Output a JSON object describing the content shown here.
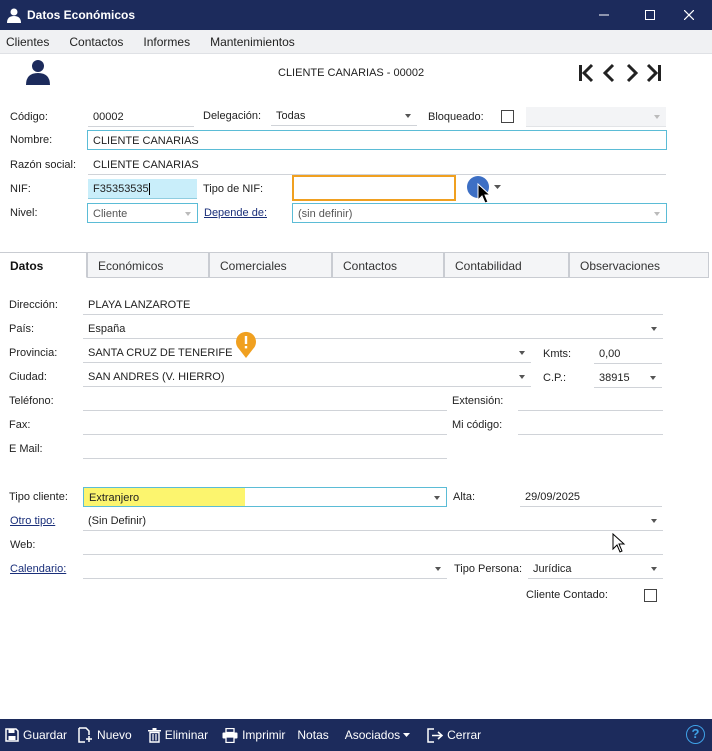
{
  "window": {
    "title": "Datos Económicos"
  },
  "menu": [
    "Clientes",
    "Contactos",
    "Informes",
    "Mantenimientos"
  ],
  "header": {
    "record_title": "CLIENTE CANARIAS - 00002"
  },
  "form": {
    "codigo_label": "Código:",
    "codigo": "00002",
    "delegacion_label": "Delegación:",
    "delegacion": "Todas",
    "bloqueado_label": "Bloqueado:",
    "nombre_label": "Nombre:",
    "nombre": "CLIENTE CANARIAS",
    "razon_label": "Razón social:",
    "razon": "CLIENTE CANARIAS",
    "nif_label": "NIF:",
    "nif": "F35353535",
    "tipo_nif_label": "Tipo de NIF:",
    "tipo_nif": "",
    "nivel_label": "Nivel:",
    "nivel": "Cliente",
    "depende_label": "Depende de:",
    "depende": "(sin definir)"
  },
  "tabs": [
    "Datos",
    "Económicos",
    "Comerciales",
    "Contactos",
    "Contabilidad",
    "Observaciones"
  ],
  "datos": {
    "direccion_label": "Dirección:",
    "direccion": "PLAYA LANZAROTE",
    "pais_label": "País:",
    "pais": "España",
    "provincia_label": "Provincia:",
    "provincia": "SANTA CRUZ DE TENERIFE",
    "kmts_label": "Kmts:",
    "kmts": "0,00",
    "ciudad_label": "Ciudad:",
    "ciudad": "SAN ANDRES (V. HIERRO)",
    "cp_label": "C.P.:",
    "cp": "38915",
    "telefono_label": "Teléfono:",
    "extension_label": "Extensión:",
    "fax_label": "Fax:",
    "micodigo_label": "Mi código:",
    "email_label": "E Mail:",
    "tipo_cliente_label": "Tipo cliente:",
    "tipo_cliente": "Extranjero",
    "alta_label": "Alta:",
    "alta": "29/09/2025",
    "otro_tipo_label": "Otro tipo:",
    "otro_tipo": "(Sin Definir)",
    "web_label": "Web:",
    "calendario_label": "Calendario:",
    "tipo_persona_label": "Tipo Persona:",
    "tipo_persona": "Jurídica",
    "cliente_contado_label": "Cliente Contado:"
  },
  "toolbar": {
    "guardar": "Guardar",
    "nuevo": "Nuevo",
    "eliminar": "Eliminar",
    "imprimir": "Imprimir",
    "notas": "Notas",
    "asociados": "Asociados",
    "cerrar": "Cerrar",
    "help": "?"
  },
  "colors": {
    "titlebar": "#1c2b5c",
    "highlight_yellow": "#fcf56e",
    "highlight_orange": "#f0a020",
    "field_border": "#5bbcd6",
    "nif_bg": "#c9eefa",
    "link": "#1a2f7a"
  },
  "icons": [
    "user-icon",
    "first-record-icon",
    "previous-record-icon",
    "next-record-icon",
    "last-record-icon",
    "warning-icon",
    "save-icon",
    "new-icon",
    "delete-icon",
    "print-icon",
    "close-icon",
    "help-icon"
  ]
}
